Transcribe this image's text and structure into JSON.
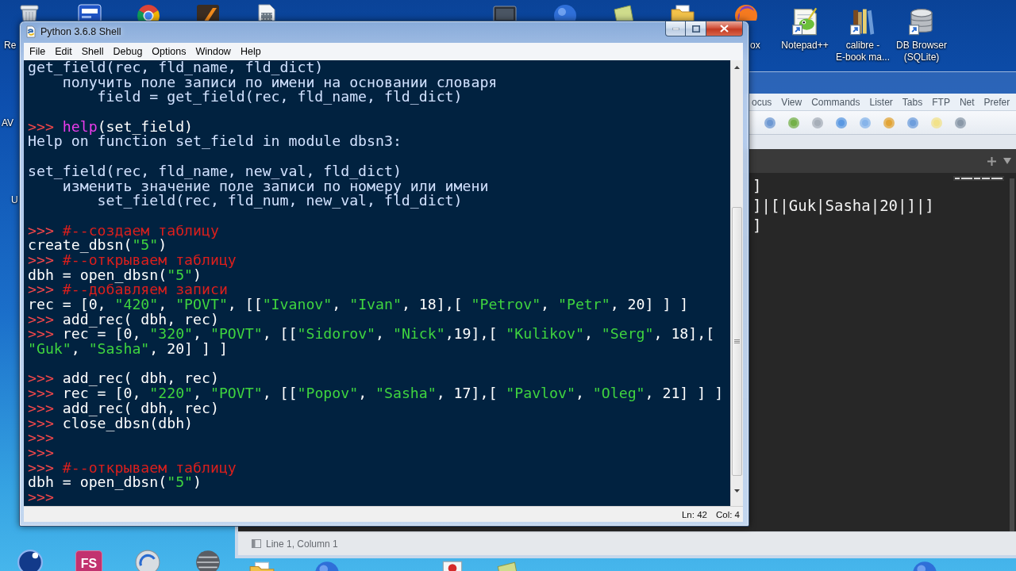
{
  "desktop": {
    "top_icons": [
      {
        "kind": "trash"
      },
      {
        "kind": "tile"
      },
      {
        "kind": "ring"
      },
      {
        "kind": "square"
      },
      {
        "kind": "film"
      },
      {
        "kind": "monitor"
      },
      {
        "kind": "circle"
      },
      {
        "kind": "paper"
      },
      {
        "kind": "folder"
      },
      {
        "kind": "orb"
      }
    ],
    "cut_labels": [
      "Re",
      "AV",
      "U",
      "ox"
    ],
    "shortcuts": [
      {
        "kind": "notepad",
        "label_lines": [
          "Notepad++"
        ]
      },
      {
        "kind": "books",
        "label_lines": [
          "calibre -",
          "E-book ma..."
        ]
      },
      {
        "kind": "database",
        "label_lines": [
          "DB Browser",
          "(SQLite)"
        ]
      }
    ],
    "bottom_icons": [
      {
        "kind": "orbit"
      },
      {
        "kind": "text_tile",
        "text": "FS"
      },
      {
        "kind": "gauge"
      },
      {
        "kind": "sphere"
      },
      {
        "kind": "folder"
      },
      {
        "kind": "circle"
      },
      {
        "kind": "document"
      },
      {
        "kind": "paper"
      },
      {
        "kind": "circle"
      }
    ]
  },
  "file_manager_window": {
    "menu": [
      "ocus",
      "View",
      "Commands",
      "Lister",
      "Tabs",
      "FTP",
      "Net",
      "Prefer"
    ]
  },
  "editor_window": {
    "lines": [
      "]",
      "]|[|Guk|Sasha|20|]|]",
      "]"
    ],
    "status": "Line 1, Column 1"
  },
  "shell_window": {
    "title": "Python 3.6.8 Shell",
    "menu": [
      "File",
      "Edit",
      "Shell",
      "Debug",
      "Options",
      "Window",
      "Help"
    ],
    "lines": [
      {
        "kind": "text",
        "parts": [
          {
            "kind": "output",
            "text": "get_field(rec, fld_name, fld_dict)"
          }
        ]
      },
      {
        "kind": "text",
        "parts": [
          {
            "kind": "output",
            "text": "    получить поле записи по имени на основании словаря"
          }
        ]
      },
      {
        "kind": "text",
        "parts": [
          {
            "kind": "output",
            "text": "        field = get_field(rec, fld_name, fld_dict)"
          }
        ]
      },
      {
        "kind": "blank"
      },
      {
        "kind": "text",
        "parts": [
          {
            "kind": "prompt",
            "text": ">>> "
          },
          {
            "kind": "builtin",
            "text": "help"
          },
          {
            "kind": "input",
            "text": "(set_field)"
          }
        ]
      },
      {
        "kind": "text",
        "parts": [
          {
            "kind": "output",
            "text": "Help on function set_field in module dbsn3:"
          }
        ]
      },
      {
        "kind": "blank"
      },
      {
        "kind": "text",
        "parts": [
          {
            "kind": "output",
            "text": "set_field(rec, fld_name, new_val, fld_dict)"
          }
        ]
      },
      {
        "kind": "text",
        "parts": [
          {
            "kind": "output",
            "text": "    изменить значение поле записи по номеру или имени"
          }
        ]
      },
      {
        "kind": "text",
        "parts": [
          {
            "kind": "output",
            "text": "        set_field(rec, fld_num, new_val, fld_dict)"
          }
        ]
      },
      {
        "kind": "blank"
      },
      {
        "kind": "text",
        "parts": [
          {
            "kind": "prompt",
            "text": ">>> "
          },
          {
            "kind": "comment",
            "text": "#--создаем таблицу"
          }
        ]
      },
      {
        "kind": "text",
        "parts": [
          {
            "kind": "input",
            "text": "create_dbsn("
          },
          {
            "kind": "string",
            "text": "\"5\""
          },
          {
            "kind": "input",
            "text": ")"
          }
        ]
      },
      {
        "kind": "text",
        "parts": [
          {
            "kind": "prompt",
            "text": ">>> "
          },
          {
            "kind": "comment",
            "text": "#--открываем таблицу"
          }
        ]
      },
      {
        "kind": "text",
        "parts": [
          {
            "kind": "input",
            "text": "dbh = open_dbsn("
          },
          {
            "kind": "string",
            "text": "\"5\""
          },
          {
            "kind": "input",
            "text": ")"
          }
        ]
      },
      {
        "kind": "text",
        "parts": [
          {
            "kind": "prompt",
            "text": ">>> "
          },
          {
            "kind": "comment",
            "text": "#--добавляем записи"
          }
        ]
      },
      {
        "kind": "text",
        "parts": [
          {
            "kind": "input",
            "text": "rec = [0, "
          },
          {
            "kind": "string",
            "text": "\"420\""
          },
          {
            "kind": "input",
            "text": ", "
          },
          {
            "kind": "string",
            "text": "\"POVT\""
          },
          {
            "kind": "input",
            "text": ", [["
          },
          {
            "kind": "string",
            "text": "\"Ivanov\""
          },
          {
            "kind": "input",
            "text": ", "
          },
          {
            "kind": "string",
            "text": "\"Ivan\""
          },
          {
            "kind": "input",
            "text": ", 18],[ "
          },
          {
            "kind": "string",
            "text": "\"Petrov\""
          },
          {
            "kind": "input",
            "text": ", "
          },
          {
            "kind": "string",
            "text": "\"Petr\""
          },
          {
            "kind": "input",
            "text": ", 20] ] ]"
          }
        ]
      },
      {
        "kind": "text",
        "parts": [
          {
            "kind": "prompt",
            "text": ">>> "
          },
          {
            "kind": "input",
            "text": "add_rec( dbh, rec)"
          }
        ]
      },
      {
        "kind": "text",
        "parts": [
          {
            "kind": "prompt",
            "text": ">>> "
          },
          {
            "kind": "input",
            "text": "rec = [0, "
          },
          {
            "kind": "string",
            "text": "\"320\""
          },
          {
            "kind": "input",
            "text": ", "
          },
          {
            "kind": "string",
            "text": "\"POVT\""
          },
          {
            "kind": "input",
            "text": ", [["
          },
          {
            "kind": "string",
            "text": "\"Sidorov\""
          },
          {
            "kind": "input",
            "text": ", "
          },
          {
            "kind": "string",
            "text": "\"Nick\""
          },
          {
            "kind": "input",
            "text": ",19],[ "
          },
          {
            "kind": "string",
            "text": "\"Kulikov\""
          },
          {
            "kind": "input",
            "text": ", "
          },
          {
            "kind": "string",
            "text": "\"Serg\""
          },
          {
            "kind": "input",
            "text": ", 18],["
          }
        ]
      },
      {
        "kind": "text",
        "parts": [
          {
            "kind": "string",
            "text": "\"Guk\""
          },
          {
            "kind": "input",
            "text": ", "
          },
          {
            "kind": "string",
            "text": "\"Sasha\""
          },
          {
            "kind": "input",
            "text": ", 20] ] ]"
          }
        ]
      },
      {
        "kind": "blank"
      },
      {
        "kind": "text",
        "parts": [
          {
            "kind": "prompt",
            "text": ">>> "
          },
          {
            "kind": "input",
            "text": "add_rec( dbh, rec)"
          }
        ]
      },
      {
        "kind": "text",
        "parts": [
          {
            "kind": "prompt",
            "text": ">>> "
          },
          {
            "kind": "input",
            "text": "rec = [0, "
          },
          {
            "kind": "string",
            "text": "\"220\""
          },
          {
            "kind": "input",
            "text": ", "
          },
          {
            "kind": "string",
            "text": "\"POVT\""
          },
          {
            "kind": "input",
            "text": ", [["
          },
          {
            "kind": "string",
            "text": "\"Popov\""
          },
          {
            "kind": "input",
            "text": ", "
          },
          {
            "kind": "string",
            "text": "\"Sasha\""
          },
          {
            "kind": "input",
            "text": ", 17],[ "
          },
          {
            "kind": "string",
            "text": "\"Pavlov\""
          },
          {
            "kind": "input",
            "text": ", "
          },
          {
            "kind": "string",
            "text": "\"Oleg\""
          },
          {
            "kind": "input",
            "text": ", 21] ] ]"
          }
        ]
      },
      {
        "kind": "text",
        "parts": [
          {
            "kind": "prompt",
            "text": ">>> "
          },
          {
            "kind": "input",
            "text": "add_rec( dbh, rec)"
          }
        ]
      },
      {
        "kind": "text",
        "parts": [
          {
            "kind": "prompt",
            "text": ">>> "
          },
          {
            "kind": "input",
            "text": "close_dbsn(dbh)"
          }
        ]
      },
      {
        "kind": "text",
        "parts": [
          {
            "kind": "prompt",
            "text": ">>>"
          }
        ]
      },
      {
        "kind": "text",
        "parts": [
          {
            "kind": "prompt",
            "text": ">>>"
          }
        ]
      },
      {
        "kind": "text",
        "parts": [
          {
            "kind": "prompt",
            "text": ">>> "
          },
          {
            "kind": "comment",
            "text": "#--открываем таблицу"
          }
        ]
      },
      {
        "kind": "text",
        "parts": [
          {
            "kind": "input",
            "text": "dbh = open_dbsn("
          },
          {
            "kind": "string",
            "text": "\"5\""
          },
          {
            "kind": "input",
            "text": ")"
          }
        ]
      },
      {
        "kind": "text",
        "parts": [
          {
            "kind": "prompt",
            "text": ">>>"
          }
        ]
      }
    ],
    "status": [
      "Ln: 42",
      "Col: 4"
    ]
  }
}
